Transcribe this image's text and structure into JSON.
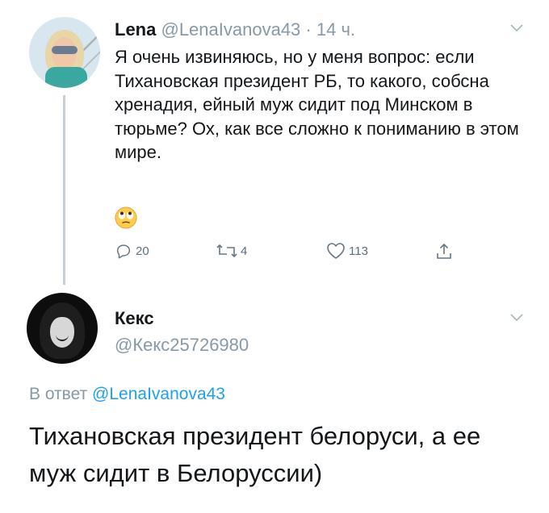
{
  "tweet1": {
    "name": "Lena",
    "handle": "@LenaIvanova43",
    "separator": "·",
    "time": "14 ч.",
    "text": "Я очень извиняюсь, но у меня вопрос: если Тихановская президент РБ, то какого, собсна хренадия, ейный муж сидит под Минском в тюрьме? Ох, как все сложно к пониманию в этом мире.",
    "emoji": "face-with-rolling-eyes",
    "replies": "20",
    "retweets": "4",
    "likes": "113"
  },
  "tweet2": {
    "name": "Кекс",
    "handle": "@Кекс25726980",
    "reply_prefix": "В ответ",
    "reply_to": "@LenaIvanova43",
    "text": "Тихановская президент белоруси, а ее муж сидит в Белоруссии)"
  },
  "colors": {
    "text": "#14171a",
    "secondary": "#8899a6",
    "link": "#1da1f2",
    "thread_line": "#c4cfd6"
  }
}
